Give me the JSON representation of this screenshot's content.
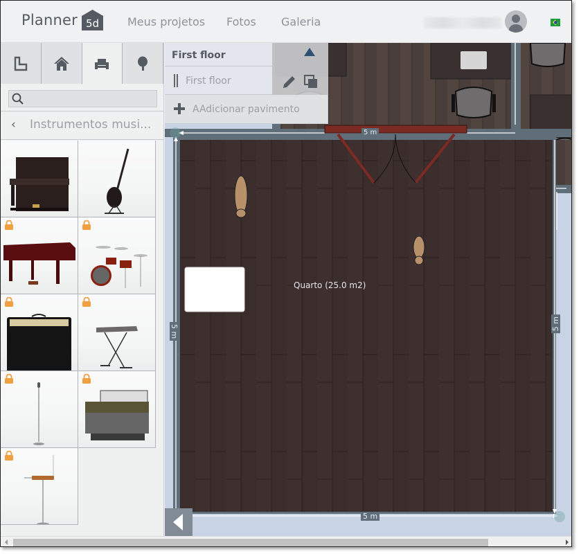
{
  "header": {
    "logo_text": "Planner",
    "logo_badge": "5d",
    "nav": [
      "Meus projetos",
      "Fotos",
      "Galeria"
    ],
    "user_name_blurred": true,
    "language_flag": "brazil-flag"
  },
  "sidebar": {
    "category_tabs": [
      {
        "icon": "room-shape-icon",
        "active": false
      },
      {
        "icon": "house-icon",
        "active": false
      },
      {
        "icon": "furniture-sofa-icon",
        "active": true
      },
      {
        "icon": "tree-icon",
        "active": false
      }
    ],
    "search": {
      "value": "",
      "placeholder": ""
    },
    "category_title": "Instrumentos musi...",
    "items": [
      {
        "name": "upright-piano",
        "locked": false
      },
      {
        "name": "electric-guitar",
        "locked": false
      },
      {
        "name": "grand-piano",
        "locked": true
      },
      {
        "name": "drum-kit",
        "locked": true
      },
      {
        "name": "guitar-amplifier",
        "locked": true
      },
      {
        "name": "keyboard-on-stand",
        "locked": true
      },
      {
        "name": "microphone-stand",
        "locked": true
      },
      {
        "name": "accordion",
        "locked": true
      },
      {
        "name": "theremin",
        "locked": true
      }
    ]
  },
  "floor_panel": {
    "header": "First floor",
    "floors": [
      {
        "label": "First floor"
      }
    ],
    "add_floor_label": "AAdicionar pavimento"
  },
  "canvas": {
    "room_label": "Quarto (25.0 m2)",
    "dimensions": {
      "top": "5 m",
      "bottom": "5 m",
      "left": "5 m",
      "right": "5 m"
    }
  },
  "colors": {
    "accent": "#555b63",
    "lock": "#f0a040",
    "floor_wood": "#3a2d2d",
    "wall": "#5f6e79",
    "door": "#7c2a24"
  }
}
